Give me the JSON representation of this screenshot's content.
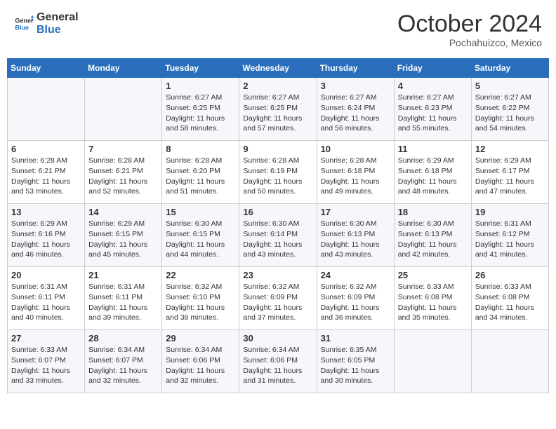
{
  "header": {
    "logo_line1": "General",
    "logo_line2": "Blue",
    "month": "October 2024",
    "location": "Pochahuizco, Mexico"
  },
  "weekdays": [
    "Sunday",
    "Monday",
    "Tuesday",
    "Wednesday",
    "Thursday",
    "Friday",
    "Saturday"
  ],
  "weeks": [
    [
      {
        "day": "",
        "sunrise": "",
        "sunset": "",
        "daylight": ""
      },
      {
        "day": "",
        "sunrise": "",
        "sunset": "",
        "daylight": ""
      },
      {
        "day": "1",
        "sunrise": "Sunrise: 6:27 AM",
        "sunset": "Sunset: 6:25 PM",
        "daylight": "Daylight: 11 hours and 58 minutes."
      },
      {
        "day": "2",
        "sunrise": "Sunrise: 6:27 AM",
        "sunset": "Sunset: 6:25 PM",
        "daylight": "Daylight: 11 hours and 57 minutes."
      },
      {
        "day": "3",
        "sunrise": "Sunrise: 6:27 AM",
        "sunset": "Sunset: 6:24 PM",
        "daylight": "Daylight: 11 hours and 56 minutes."
      },
      {
        "day": "4",
        "sunrise": "Sunrise: 6:27 AM",
        "sunset": "Sunset: 6:23 PM",
        "daylight": "Daylight: 11 hours and 55 minutes."
      },
      {
        "day": "5",
        "sunrise": "Sunrise: 6:27 AM",
        "sunset": "Sunset: 6:22 PM",
        "daylight": "Daylight: 11 hours and 54 minutes."
      }
    ],
    [
      {
        "day": "6",
        "sunrise": "Sunrise: 6:28 AM",
        "sunset": "Sunset: 6:21 PM",
        "daylight": "Daylight: 11 hours and 53 minutes."
      },
      {
        "day": "7",
        "sunrise": "Sunrise: 6:28 AM",
        "sunset": "Sunset: 6:21 PM",
        "daylight": "Daylight: 11 hours and 52 minutes."
      },
      {
        "day": "8",
        "sunrise": "Sunrise: 6:28 AM",
        "sunset": "Sunset: 6:20 PM",
        "daylight": "Daylight: 11 hours and 51 minutes."
      },
      {
        "day": "9",
        "sunrise": "Sunrise: 6:28 AM",
        "sunset": "Sunset: 6:19 PM",
        "daylight": "Daylight: 11 hours and 50 minutes."
      },
      {
        "day": "10",
        "sunrise": "Sunrise: 6:28 AM",
        "sunset": "Sunset: 6:18 PM",
        "daylight": "Daylight: 11 hours and 49 minutes."
      },
      {
        "day": "11",
        "sunrise": "Sunrise: 6:29 AM",
        "sunset": "Sunset: 6:18 PM",
        "daylight": "Daylight: 11 hours and 48 minutes."
      },
      {
        "day": "12",
        "sunrise": "Sunrise: 6:29 AM",
        "sunset": "Sunset: 6:17 PM",
        "daylight": "Daylight: 11 hours and 47 minutes."
      }
    ],
    [
      {
        "day": "13",
        "sunrise": "Sunrise: 6:29 AM",
        "sunset": "Sunset: 6:16 PM",
        "daylight": "Daylight: 11 hours and 46 minutes."
      },
      {
        "day": "14",
        "sunrise": "Sunrise: 6:29 AM",
        "sunset": "Sunset: 6:15 PM",
        "daylight": "Daylight: 11 hours and 45 minutes."
      },
      {
        "day": "15",
        "sunrise": "Sunrise: 6:30 AM",
        "sunset": "Sunset: 6:15 PM",
        "daylight": "Daylight: 11 hours and 44 minutes."
      },
      {
        "day": "16",
        "sunrise": "Sunrise: 6:30 AM",
        "sunset": "Sunset: 6:14 PM",
        "daylight": "Daylight: 11 hours and 43 minutes."
      },
      {
        "day": "17",
        "sunrise": "Sunrise: 6:30 AM",
        "sunset": "Sunset: 6:13 PM",
        "daylight": "Daylight: 11 hours and 43 minutes."
      },
      {
        "day": "18",
        "sunrise": "Sunrise: 6:30 AM",
        "sunset": "Sunset: 6:13 PM",
        "daylight": "Daylight: 11 hours and 42 minutes."
      },
      {
        "day": "19",
        "sunrise": "Sunrise: 6:31 AM",
        "sunset": "Sunset: 6:12 PM",
        "daylight": "Daylight: 11 hours and 41 minutes."
      }
    ],
    [
      {
        "day": "20",
        "sunrise": "Sunrise: 6:31 AM",
        "sunset": "Sunset: 6:11 PM",
        "daylight": "Daylight: 11 hours and 40 minutes."
      },
      {
        "day": "21",
        "sunrise": "Sunrise: 6:31 AM",
        "sunset": "Sunset: 6:11 PM",
        "daylight": "Daylight: 11 hours and 39 minutes."
      },
      {
        "day": "22",
        "sunrise": "Sunrise: 6:32 AM",
        "sunset": "Sunset: 6:10 PM",
        "daylight": "Daylight: 11 hours and 38 minutes."
      },
      {
        "day": "23",
        "sunrise": "Sunrise: 6:32 AM",
        "sunset": "Sunset: 6:09 PM",
        "daylight": "Daylight: 11 hours and 37 minutes."
      },
      {
        "day": "24",
        "sunrise": "Sunrise: 6:32 AM",
        "sunset": "Sunset: 6:09 PM",
        "daylight": "Daylight: 11 hours and 36 minutes."
      },
      {
        "day": "25",
        "sunrise": "Sunrise: 6:33 AM",
        "sunset": "Sunset: 6:08 PM",
        "daylight": "Daylight: 11 hours and 35 minutes."
      },
      {
        "day": "26",
        "sunrise": "Sunrise: 6:33 AM",
        "sunset": "Sunset: 6:08 PM",
        "daylight": "Daylight: 11 hours and 34 minutes."
      }
    ],
    [
      {
        "day": "27",
        "sunrise": "Sunrise: 6:33 AM",
        "sunset": "Sunset: 6:07 PM",
        "daylight": "Daylight: 11 hours and 33 minutes."
      },
      {
        "day": "28",
        "sunrise": "Sunrise: 6:34 AM",
        "sunset": "Sunset: 6:07 PM",
        "daylight": "Daylight: 11 hours and 32 minutes."
      },
      {
        "day": "29",
        "sunrise": "Sunrise: 6:34 AM",
        "sunset": "Sunset: 6:06 PM",
        "daylight": "Daylight: 11 hours and 32 minutes."
      },
      {
        "day": "30",
        "sunrise": "Sunrise: 6:34 AM",
        "sunset": "Sunset: 6:06 PM",
        "daylight": "Daylight: 11 hours and 31 minutes."
      },
      {
        "day": "31",
        "sunrise": "Sunrise: 6:35 AM",
        "sunset": "Sunset: 6:05 PM",
        "daylight": "Daylight: 11 hours and 30 minutes."
      },
      {
        "day": "",
        "sunrise": "",
        "sunset": "",
        "daylight": ""
      },
      {
        "day": "",
        "sunrise": "",
        "sunset": "",
        "daylight": ""
      }
    ]
  ]
}
